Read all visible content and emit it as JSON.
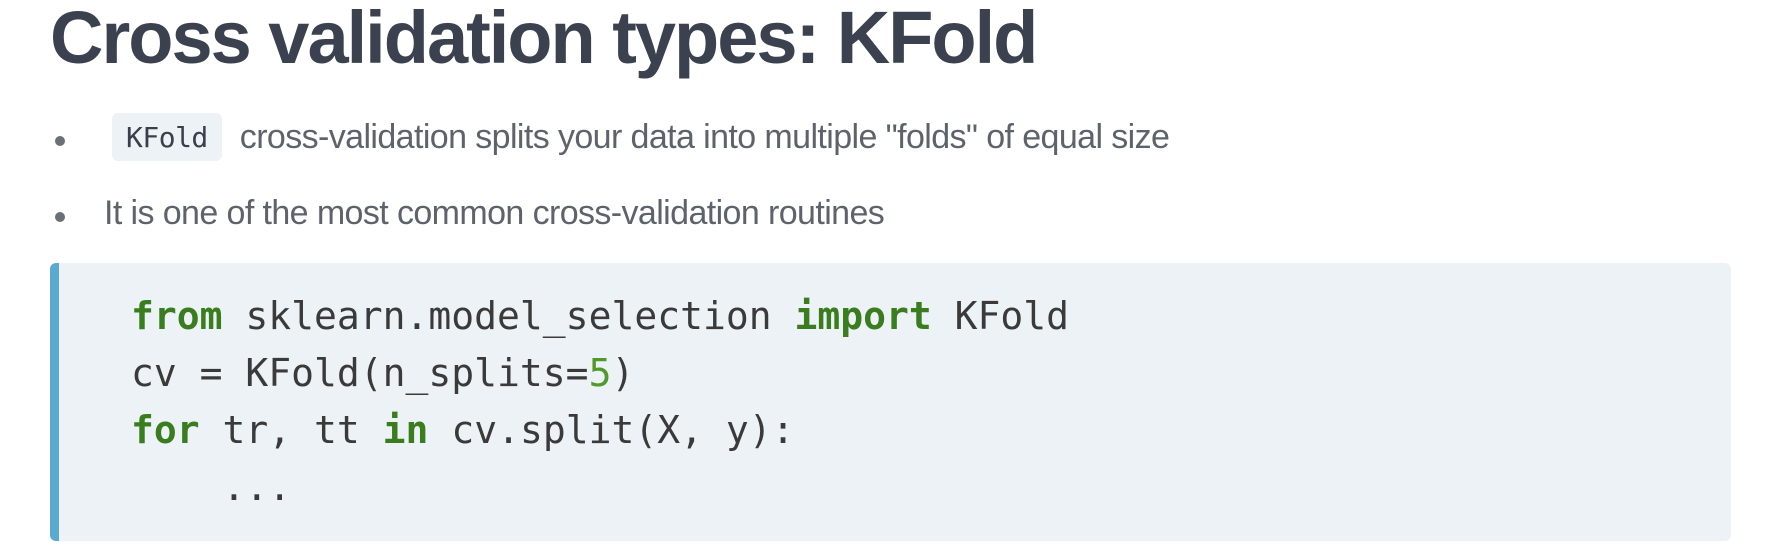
{
  "slide": {
    "title": "Cross validation types: KFold"
  },
  "bullets": [
    {
      "code": "KFold",
      "text": "cross-validation splits your data into multiple \"folds\" of equal size"
    },
    {
      "text": "It is one of the most common cross-validation routines"
    }
  ],
  "code_block": {
    "line1": {
      "kw_from": "from",
      "module": " sklearn.model_selection ",
      "kw_import": "import",
      "name": " KFold"
    },
    "line2": {
      "prefix": "cv = KFold(n_splits=",
      "number": "5",
      "suffix": ")"
    },
    "line3": {
      "kw_for": "for",
      "mid": " tr, tt ",
      "kw_in": "in",
      "rest": " cv.split(X, y):"
    },
    "line4": {
      "indent": "    ",
      "ellipsis": "..."
    }
  },
  "colors": {
    "title": "#3c4150",
    "bullet_text": "#5e636b",
    "code_background": "#edf2f6",
    "code_accent_border": "#5aa9cf",
    "keyword": "#3a7d1e",
    "number": "#4f9a2a"
  }
}
